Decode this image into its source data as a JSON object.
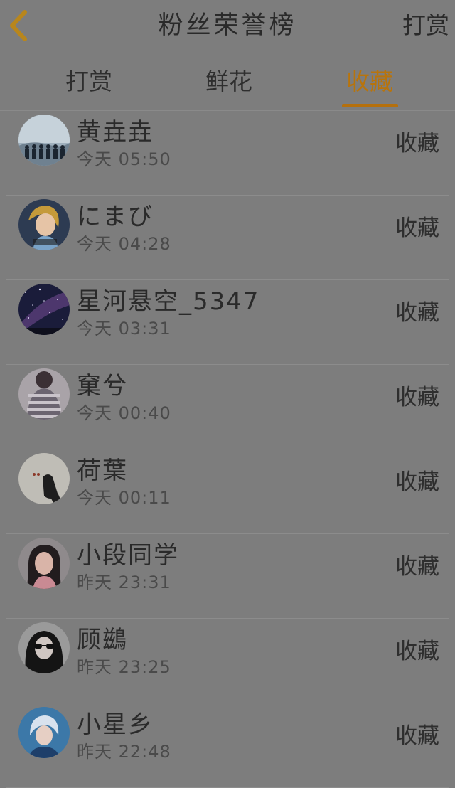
{
  "header": {
    "title": "粉丝荣誉榜",
    "action": "打赏"
  },
  "colors": {
    "background": "#7d7d7d",
    "accent": "#b5700d",
    "back_arrow": "#b8861c"
  },
  "tabs": [
    {
      "label": "打赏",
      "active": false
    },
    {
      "label": "鲜花",
      "active": false
    },
    {
      "label": "收藏",
      "active": true
    }
  ],
  "fans": [
    {
      "name": "黄垚垚",
      "time": "今天 05:50",
      "action": "收藏",
      "avatar_icon": "silhouettes-sky-avatar"
    },
    {
      "name": "にまび",
      "time": "今天 04:28",
      "action": "收藏",
      "avatar_icon": "cartoon-princess-avatar"
    },
    {
      "name": "星河悬空_5347",
      "time": "今天 03:31",
      "action": "收藏",
      "avatar_icon": "starry-sky-avatar"
    },
    {
      "name": "窠兮",
      "time": "今天 00:40",
      "action": "收藏",
      "avatar_icon": "striped-sweater-avatar"
    },
    {
      "name": "荷葉",
      "time": "今天 00:11",
      "action": "收藏",
      "avatar_icon": "dark-figure-avatar"
    },
    {
      "name": "小段同学",
      "time": "昨天 23:31",
      "action": "收藏",
      "avatar_icon": "girl-portrait-avatar"
    },
    {
      "name": "顾鷀",
      "time": "昨天 23:25",
      "action": "收藏",
      "avatar_icon": "sunglasses-girl-avatar"
    },
    {
      "name": "小星乡",
      "time": "昨天 22:48",
      "action": "收藏",
      "avatar_icon": "blue-portrait-avatar"
    }
  ]
}
